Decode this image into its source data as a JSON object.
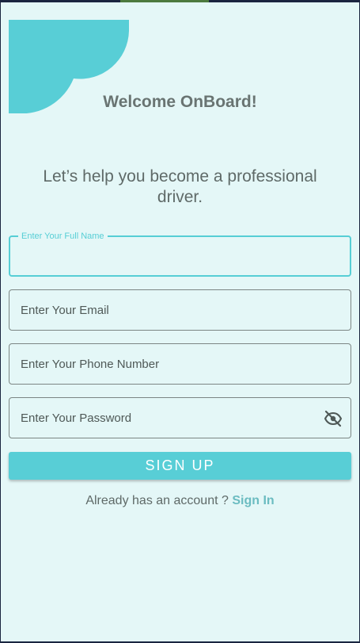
{
  "header": {
    "title": "Welcome OnBoard!",
    "subtitle": "Let’s help you become a professional driver."
  },
  "form": {
    "full_name": {
      "label": "Enter Your Full Name",
      "value": ""
    },
    "email": {
      "placeholder": "Enter Your Email"
    },
    "phone": {
      "placeholder": "Enter Your Phone Number"
    },
    "password": {
      "placeholder": "Enter Your Password",
      "visibility_icon": "eye-off-icon"
    },
    "submit_label": "SIGN UP"
  },
  "footer": {
    "prompt": "Already has an account ?",
    "link": "Sign In"
  },
  "colors": {
    "accent": "#58ced6",
    "background": "#e4f7f7",
    "link": "#6bbcc1",
    "text": "#5f6a68"
  }
}
